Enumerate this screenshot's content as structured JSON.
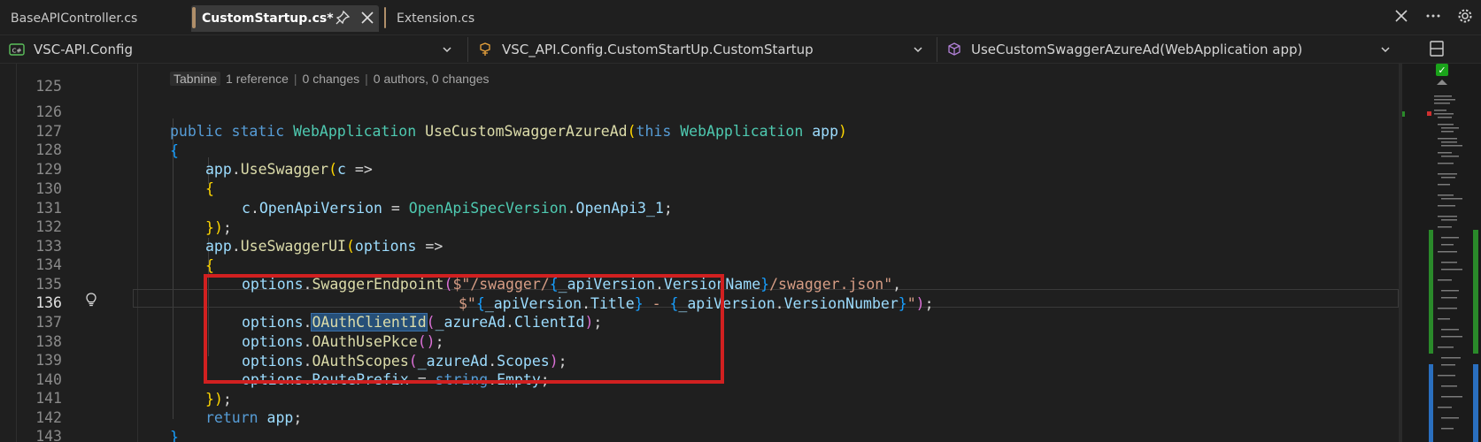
{
  "tabs": [
    {
      "label": "BaseAPIController.cs"
    },
    {
      "label": "CustomStartup.cs*"
    },
    {
      "label": "Extension.cs"
    }
  ],
  "nav": {
    "project": "VSC-API.Config",
    "class": "VSC_API.Config.CustomStartUp.CustomStartup",
    "member": "UseCustomSwaggerAzureAd(WebApplication app)"
  },
  "codelens": {
    "tabnine": "Tabnine",
    "references": "1 reference",
    "changes": "0 changes",
    "authors": "0 authors, 0 changes"
  },
  "line_numbers": [
    "125",
    "126",
    "127",
    "128",
    "129",
    "130",
    "131",
    "132",
    "133",
    "134",
    "135",
    "136",
    "137",
    "138",
    "139",
    "140",
    "141",
    "142",
    "143"
  ],
  "active_line": "136",
  "code": {
    "l126": {
      "k1": "public",
      "k2": "static",
      "t1": "WebApplication",
      "f1": "UseCustomSwaggerAzureAd",
      "p1": "(",
      "k3": "this",
      "t2": "WebApplication",
      "v1": "app",
      "p2": ")"
    },
    "l127": {
      "b": "{"
    },
    "l128": {
      "v": "app",
      "d": ".",
      "f": "UseSwagger",
      "p": "(",
      "v2": "c",
      "a": " =>"
    },
    "l129": {
      "b": "{"
    },
    "l130": {
      "v": "c",
      "d": ".",
      "v2": "OpenApiVersion",
      "eq": " = ",
      "t": "OpenApiSpecVersion",
      "d2": ".",
      "v3": "OpenApi3_1",
      "sc": ";"
    },
    "l131": {
      "b": "}",
      "p": ")",
      "sc": ";"
    },
    "l132": {
      "v": "app",
      "d": ".",
      "f": "UseSwaggerUI",
      "p": "(",
      "v2": "options",
      "a": " =>"
    },
    "l133": {
      "b": "{"
    },
    "l134": {
      "v": "options",
      "d": ".",
      "f": "SwaggerEndpoint",
      "p": "(",
      "s1": "$\"/swagger/",
      "b1": "{",
      "v2": "_apiVersion",
      "d2": ".",
      "v3": "VersionName",
      "b2": "}",
      "s2": "/swagger.json\"",
      "c": ","
    },
    "l135": {
      "s1": "$\"",
      "b1": "{",
      "v1": "_apiVersion",
      "d1": ".",
      "v2": "Title",
      "b2": "}",
      "s2": " - ",
      "b3": "{",
      "v3": "_apiVersion",
      "d2": ".",
      "v4": "VersionNumber",
      "b4": "}",
      "s3": "\"",
      "p": ")",
      "sc": ";"
    },
    "l136": {
      "v": "options",
      "d": ".",
      "f": "OAuthClientId",
      "p": "(",
      "v2": "_azureAd",
      "d2": ".",
      "v3": "ClientId",
      "p2": ")",
      "sc": ";"
    },
    "l137": {
      "v": "options",
      "d": ".",
      "f": "OAuthUsePkce",
      "p": "()",
      "sc": ";"
    },
    "l138": {
      "v": "options",
      "d": ".",
      "f": "OAuthScopes",
      "p": "(",
      "v2": "_azureAd",
      "d2": ".",
      "v3": "Scopes",
      "p2": ")",
      "sc": ";"
    },
    "l139": {
      "v": "options",
      "d": ".",
      "v2": "RoutePrefix",
      "eq": " = ",
      "k": "string",
      "d2": ".",
      "v3": "Empty",
      "sc": ";"
    },
    "l140": {
      "b": "}",
      "p": ")",
      "sc": ";"
    },
    "l141": {
      "k": "return",
      "v": " app",
      "sc": ";"
    },
    "l142": {
      "b": "}"
    }
  },
  "colors": {
    "highlight_box": "#d12020",
    "selection": "#264f78",
    "minimap_ok": "#1aa31a"
  },
  "icons": {
    "close_all": "close-icon",
    "more": "more-icon",
    "settings": "gear-icon",
    "lightbulb": "lightbulb-icon"
  }
}
